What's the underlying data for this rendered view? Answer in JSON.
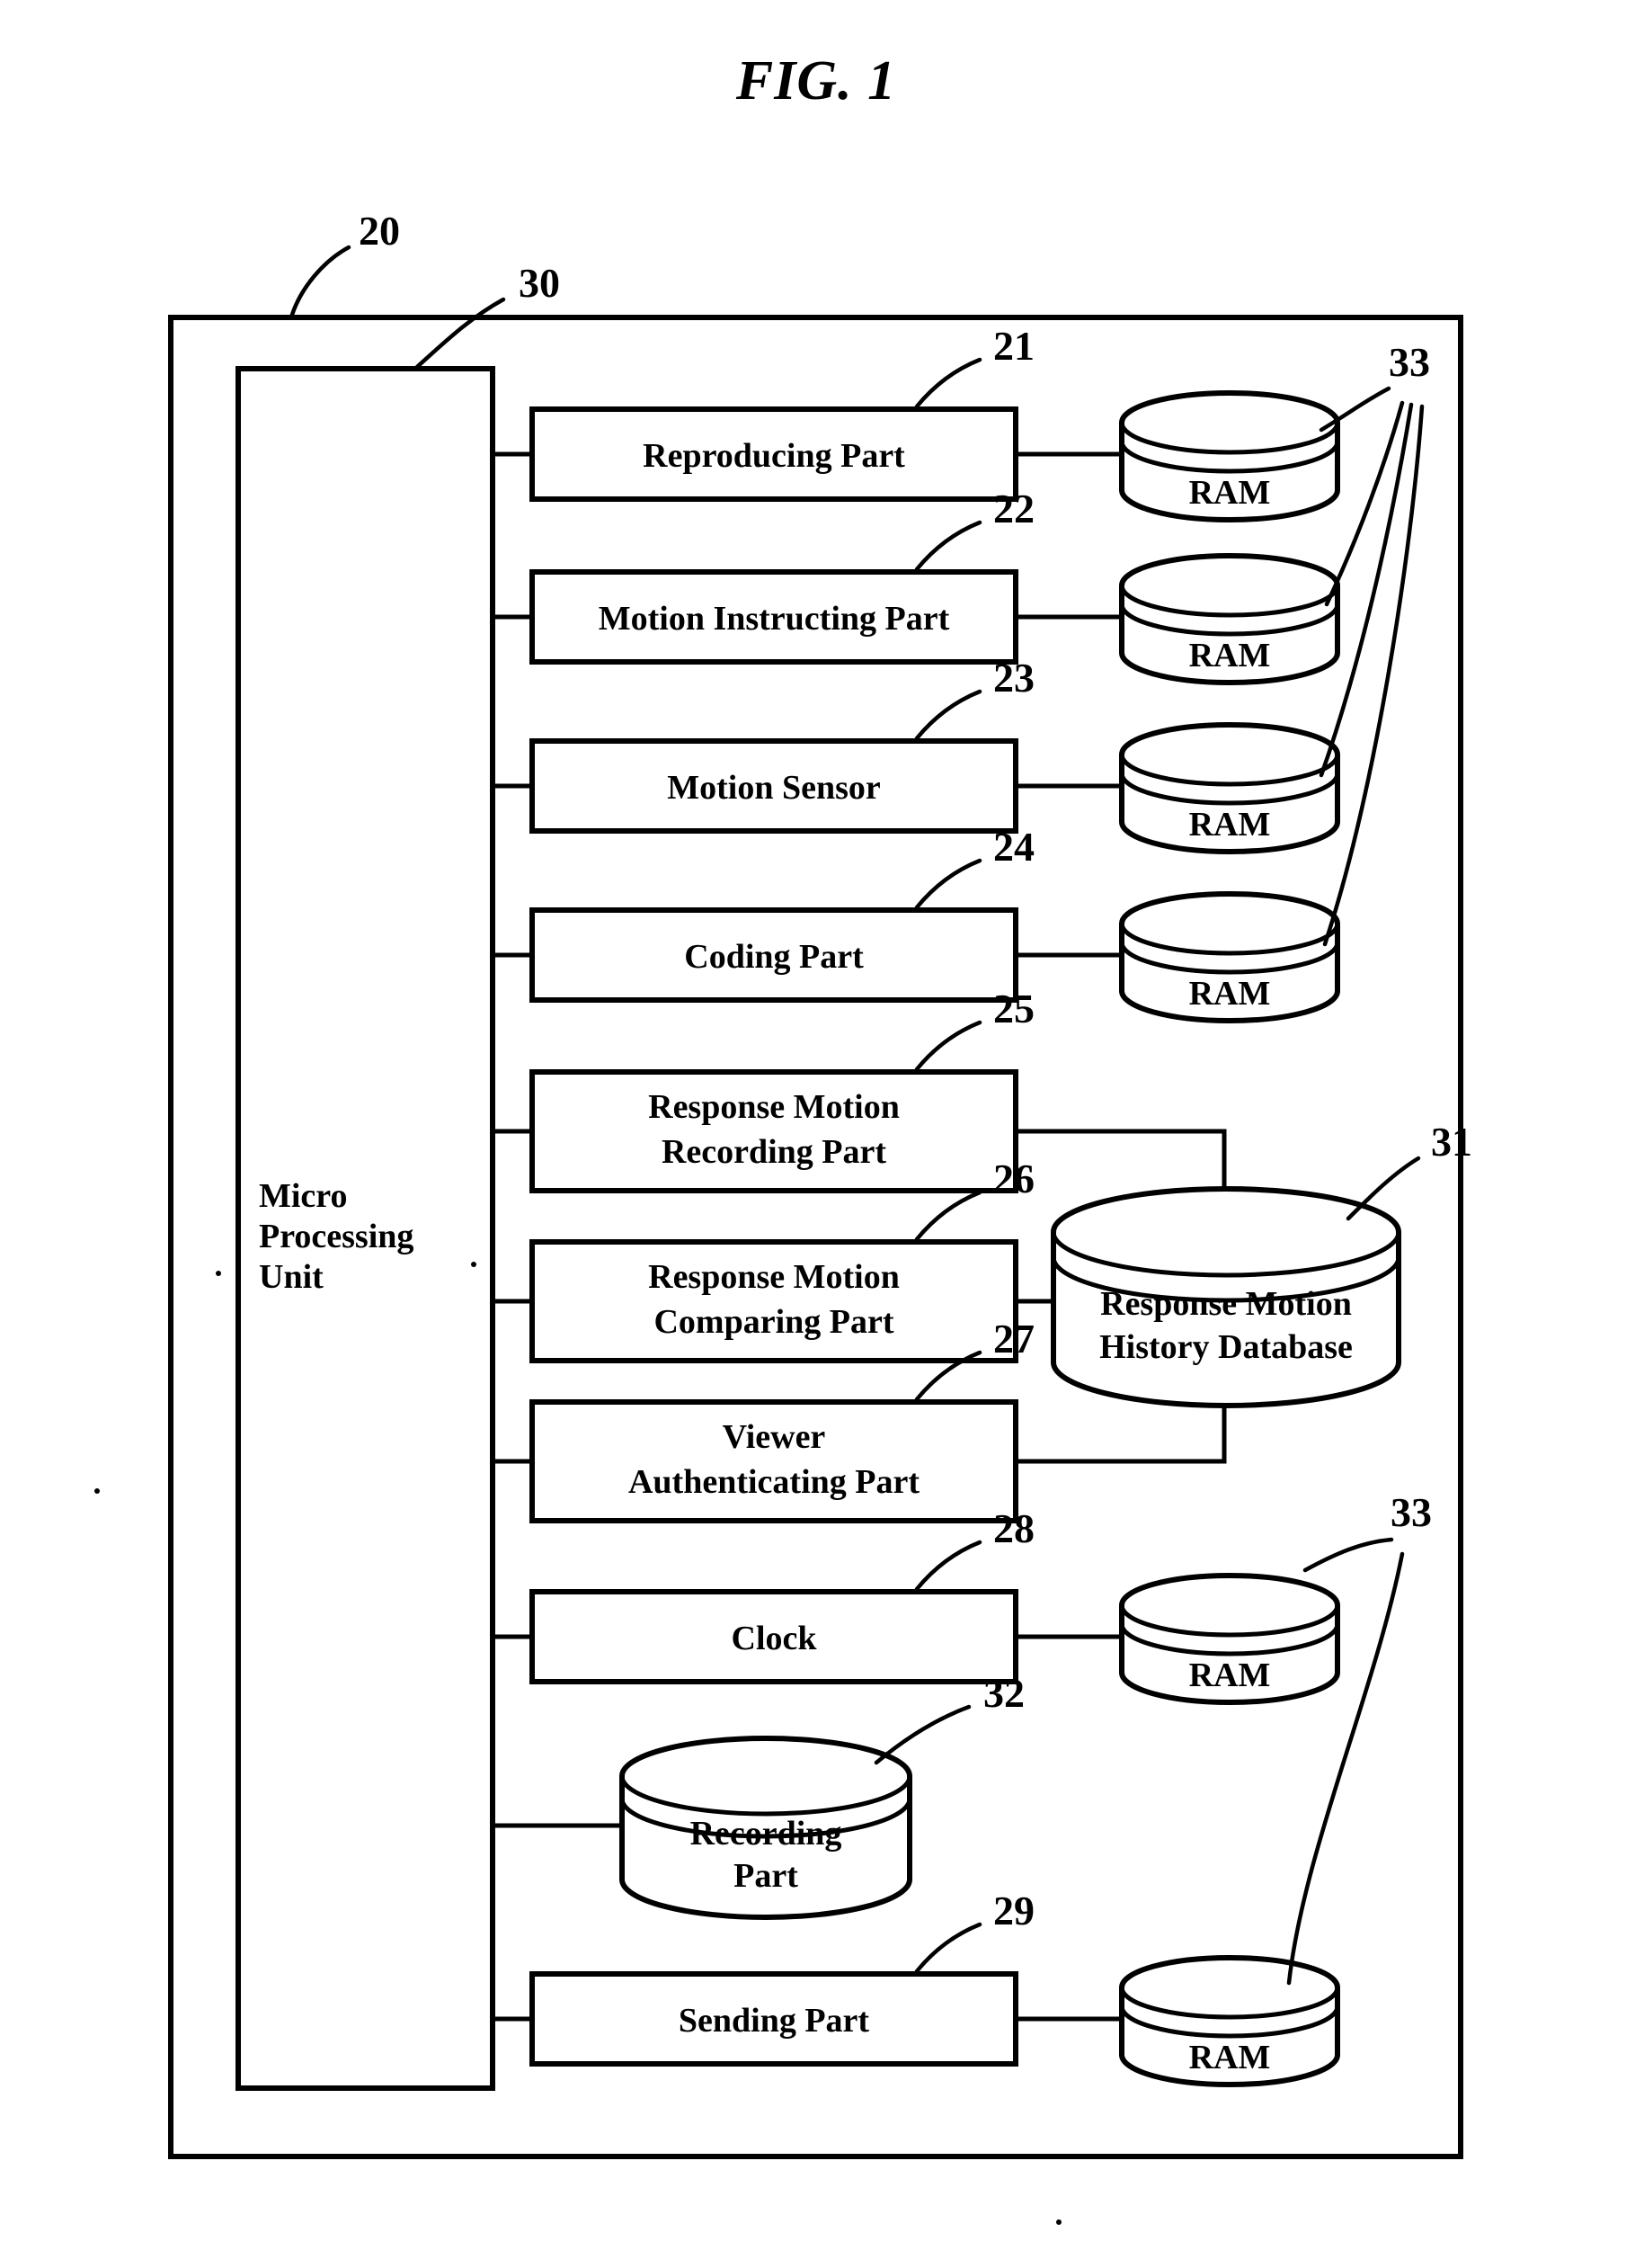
{
  "figure": {
    "title": "FIG. 1",
    "outer_box_ref": "20",
    "mpu_box_ref": "30",
    "mpu_label_lines": [
      "Micro",
      "Processing",
      "Unit"
    ]
  },
  "blocks": [
    {
      "id": "reproducing-part",
      "ref": "21",
      "lines": [
        "Reproducing Part"
      ]
    },
    {
      "id": "motion-instructing-part",
      "ref": "22",
      "lines": [
        "Motion Instructing Part"
      ]
    },
    {
      "id": "motion-sensor",
      "ref": "23",
      "lines": [
        "Motion Sensor"
      ]
    },
    {
      "id": "coding-part",
      "ref": "24",
      "lines": [
        "Coding Part"
      ]
    },
    {
      "id": "response-motion-recording-part",
      "ref": "25",
      "lines": [
        "Response Motion",
        "Recording Part"
      ]
    },
    {
      "id": "response-motion-comparing-part",
      "ref": "26",
      "lines": [
        "Response Motion",
        "Comparing Part"
      ]
    },
    {
      "id": "viewer-authenticating-part",
      "ref": "27",
      "lines": [
        "Viewer",
        "Authenticating Part"
      ]
    },
    {
      "id": "clock",
      "ref": "28",
      "lines": [
        "Clock"
      ]
    },
    {
      "id": "sending-part",
      "ref": "29",
      "lines": [
        "Sending Part"
      ]
    }
  ],
  "cylinders": [
    {
      "id": "ram-reproducing",
      "ref": null,
      "lines": [
        "RAM"
      ]
    },
    {
      "id": "ram-motion-instructing",
      "ref": null,
      "lines": [
        "RAM"
      ]
    },
    {
      "id": "ram-motion-sensor",
      "ref": null,
      "lines": [
        "RAM"
      ]
    },
    {
      "id": "ram-coding",
      "ref": null,
      "lines": [
        "RAM"
      ]
    },
    {
      "id": "response-motion-history-database",
      "ref": "31",
      "lines": [
        "Response Motion",
        "History Database"
      ]
    },
    {
      "id": "ram-clock",
      "ref": null,
      "lines": [
        "RAM"
      ]
    },
    {
      "id": "recording-part",
      "ref": "32",
      "lines": [
        "Recording",
        "Part"
      ]
    },
    {
      "id": "ram-sending",
      "ref": null,
      "lines": [
        "RAM"
      ]
    }
  ],
  "ram_group_refs": {
    "top": "33",
    "bottom": "33"
  },
  "colors": {
    "ink": "#000000",
    "paper": "#ffffff"
  }
}
